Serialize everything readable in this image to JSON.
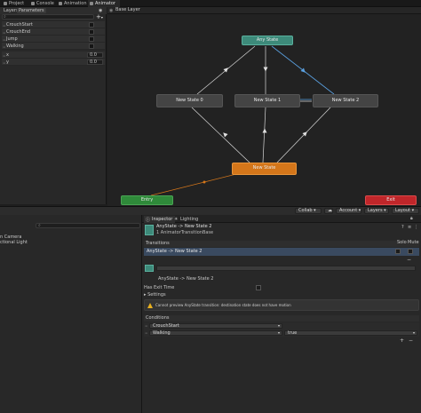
{
  "top_tabs": [
    {
      "label": "Project"
    },
    {
      "label": "Console"
    },
    {
      "label": "Animation"
    },
    {
      "label": "Animator"
    }
  ],
  "left_panel": {
    "tabs": [
      "Layers",
      "Parameters"
    ],
    "add_label": "+",
    "params": [
      {
        "name": "CrouchStart",
        "type": "bool"
      },
      {
        "name": "CrouchEnd",
        "type": "bool"
      },
      {
        "name": "Jump",
        "type": "bool"
      },
      {
        "name": "Walking",
        "type": "bool"
      },
      {
        "name": "x",
        "type": "float",
        "value": "0.0"
      },
      {
        "name": "y",
        "type": "float",
        "value": "0.0"
      }
    ]
  },
  "graph": {
    "breadcrumb": "Base Layer",
    "states": {
      "any": "Any State",
      "s0": "New State 0",
      "s1": "New State 1",
      "s2": "New State 2",
      "default": "New State",
      "entry": "Entry",
      "exit": "Exit"
    }
  },
  "toolbar": {
    "collab": "Collab ▾",
    "account": "Account ▾",
    "layers": "Layers ▾",
    "layout": "Layout ▾"
  },
  "hierarchy": {
    "items": [
      "n Camera",
      "ctional Light"
    ]
  },
  "inspector": {
    "tabs": [
      "Inspector",
      "Lighting"
    ],
    "title": "AnyState -> New State 2",
    "subtitle": "1 AnimatorTransitionBase",
    "transitions_header": "Transitions",
    "solo_label": "Solo",
    "mute_label": "Mute",
    "transition_item": "AnyState -> New State 2",
    "transition_name": "AnyState -> New State 2",
    "has_exit_time": "Has Exit Time",
    "settings": "▸ Settings",
    "warning": "Cannot preview AnyState transition: destination state does not have motion",
    "conditions_header": "Conditions",
    "conditions": [
      {
        "param": "CrouchStart",
        "value": ""
      },
      {
        "param": "Walking",
        "value": "true"
      }
    ]
  },
  "colors": {
    "any_state": "#3d8a7a",
    "default_state": "#d4761a",
    "entry": "#2f8a3a",
    "exit": "#c0262a",
    "state": "#444444",
    "selected_transition": "#5aa0e0"
  }
}
